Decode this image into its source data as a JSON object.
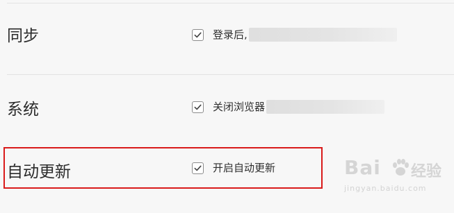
{
  "settings": {
    "sync": {
      "title": "同步",
      "option_label": "登录后,",
      "checked": true
    },
    "system": {
      "title": "系统",
      "option_label": "关闭浏览器",
      "checked": true
    },
    "auto_update": {
      "title": "自动更新",
      "option_label": "开启自动更新",
      "checked": true
    }
  },
  "watermark": {
    "brand": "Bai",
    "suffix": "经验",
    "url": "jingyan.baidu.com"
  },
  "colors": {
    "background": "#f7f7f7",
    "highlight_border": "#d91a1a",
    "checkbox_border": "#8c8c8c",
    "check_mark": "#444444"
  }
}
